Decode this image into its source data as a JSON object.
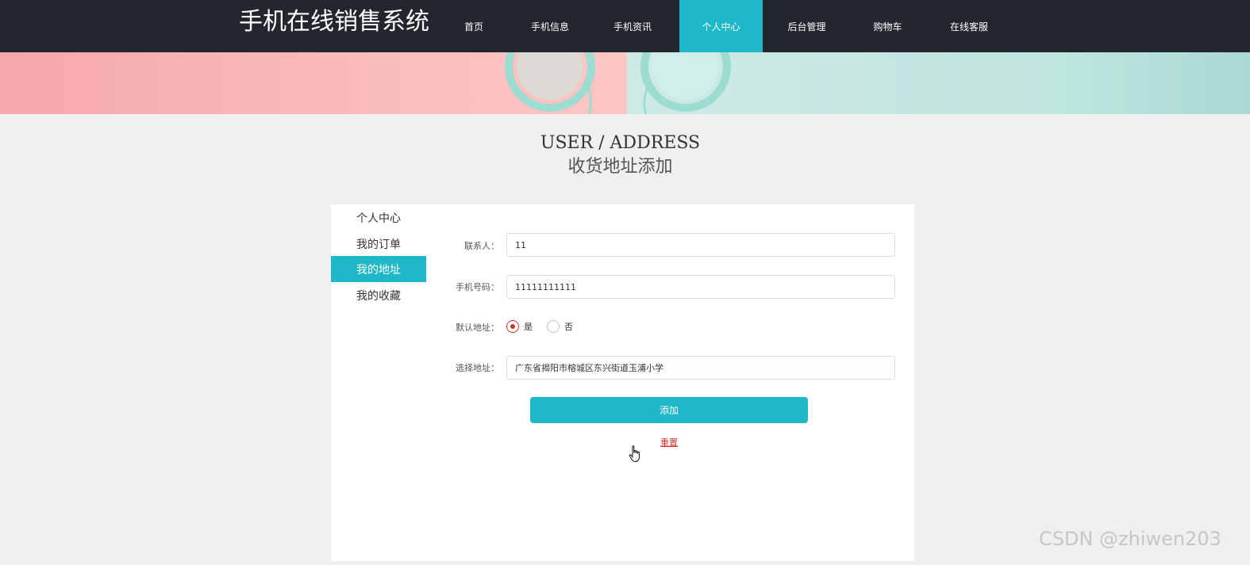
{
  "header": {
    "title": "手机在线销售系统",
    "nav": [
      {
        "label": "首页",
        "active": false
      },
      {
        "label": "手机信息",
        "active": false
      },
      {
        "label": "手机资讯",
        "active": false
      },
      {
        "label": "个人中心",
        "active": true
      },
      {
        "label": "后台管理",
        "active": false
      },
      {
        "label": "购物车",
        "active": false
      },
      {
        "label": "在线客服",
        "active": false
      }
    ]
  },
  "page": {
    "heading_en": "USER / ADDRESS",
    "heading_cn": "收货地址添加"
  },
  "sidebar": {
    "items": [
      {
        "label": "个人中心",
        "active": false
      },
      {
        "label": "我的订单",
        "active": false
      },
      {
        "label": "我的地址",
        "active": true
      },
      {
        "label": "我的收藏",
        "active": false
      }
    ]
  },
  "form": {
    "contact": {
      "label": "联系人：",
      "value": "11"
    },
    "phone": {
      "label": "手机号码：",
      "value": "11111111111"
    },
    "default_address": {
      "label": "默认地址：",
      "options": [
        {
          "label": "是",
          "checked": true
        },
        {
          "label": "否",
          "checked": false
        }
      ]
    },
    "address": {
      "label": "选择地址：",
      "value": "广东省揭阳市榕城区东兴街道玉浦小学"
    },
    "submit_label": "添加",
    "reset_label": "重置"
  },
  "watermark": "CSDN @zhiwen203",
  "colors": {
    "accent": "#1fb8c8",
    "header_bg": "#23262f",
    "danger": "#d0342c",
    "page_bg": "#efeef0"
  }
}
